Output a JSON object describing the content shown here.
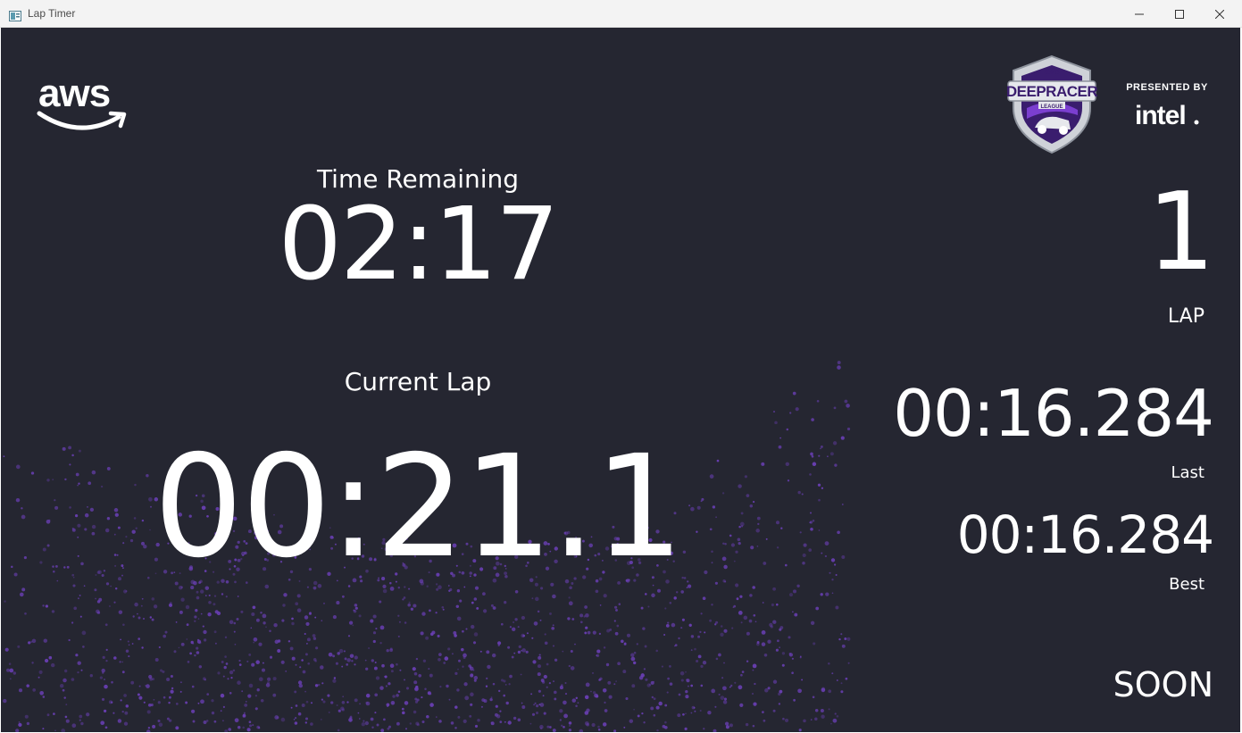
{
  "window": {
    "title": "Lap Timer"
  },
  "presented_by": "PRESENTED BY",
  "timer": {
    "time_remaining_label": "Time Remaining",
    "time_remaining": "02:17",
    "current_lap_label": "Current Lap",
    "current_lap": "00:21.1"
  },
  "laps": {
    "count": "1",
    "count_label": "LAP",
    "last": "00:16.284",
    "last_label": "Last",
    "best": "00:16.284",
    "best_label": "Best"
  },
  "status": "SOON",
  "logos": {
    "aws": "aws-logo",
    "deepracer": "aws-deepracer-league-logo",
    "intel": "intel-logo"
  },
  "colors": {
    "background": "#252631",
    "particles": "#6a3fb5",
    "text": "#ffffff"
  }
}
